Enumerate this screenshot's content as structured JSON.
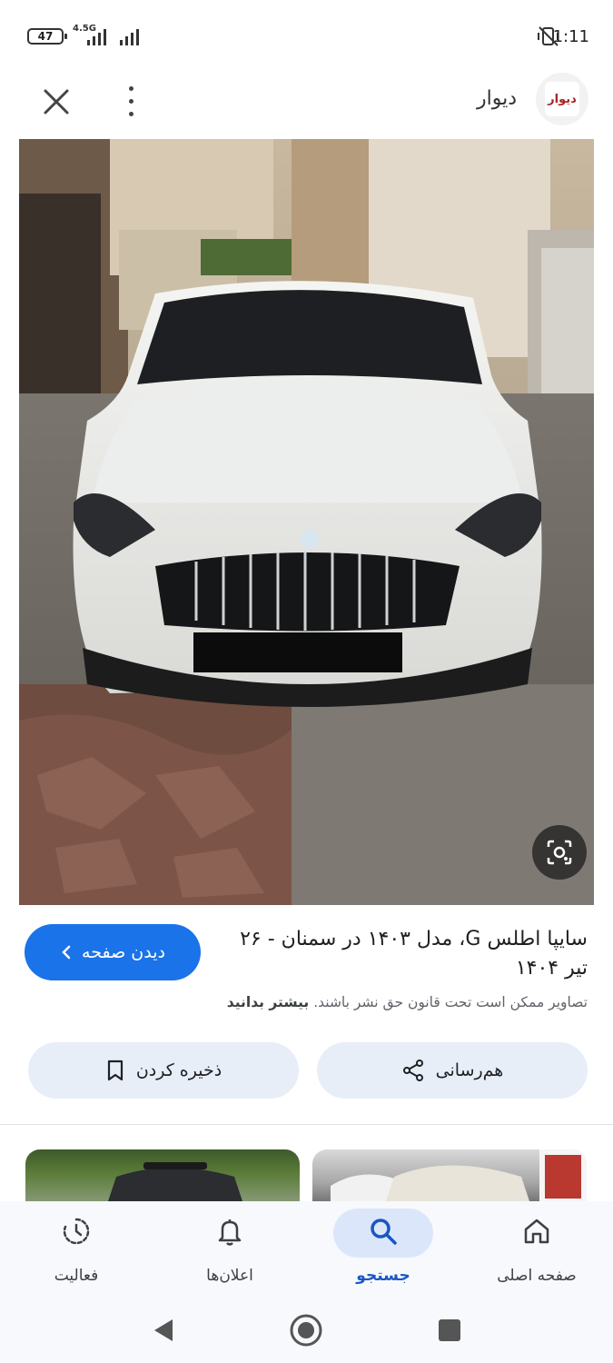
{
  "status_bar": {
    "battery": "47",
    "network": "4.5G",
    "time": "1:11"
  },
  "header": {
    "site_name": "دیوار",
    "logo_text": "دیوار",
    "close_icon": "close-icon",
    "more_icon": "more-vert-icon"
  },
  "image": {
    "description_icon": "google-lens-icon"
  },
  "result": {
    "title": "سایپا اطلس G، مدل ۱۴۰۳ در سمنان - ۲۶ تیر ۱۴۰۴",
    "visit_label": "دیدن صفحه",
    "copyright_text": "تصاویر ممکن است تحت قانون حق نشر باشند.",
    "learn_more": "بیشتر بدانید"
  },
  "actions": {
    "share_label": "هم‌رسانی",
    "save_label": "ذخیره کردن"
  },
  "bottom_nav": {
    "items": [
      {
        "label": "صفحه اصلی",
        "icon": "home-icon",
        "active": false
      },
      {
        "label": "جستجو",
        "icon": "search-icon",
        "active": true
      },
      {
        "label": "اعلان‌ها",
        "icon": "bell-icon",
        "active": false
      },
      {
        "label": "فعالیت",
        "icon": "activity-icon",
        "active": false
      }
    ]
  },
  "colors": {
    "accent": "#1a73e8",
    "pill": "#dce6fb",
    "action_bg": "#e8eef8"
  }
}
